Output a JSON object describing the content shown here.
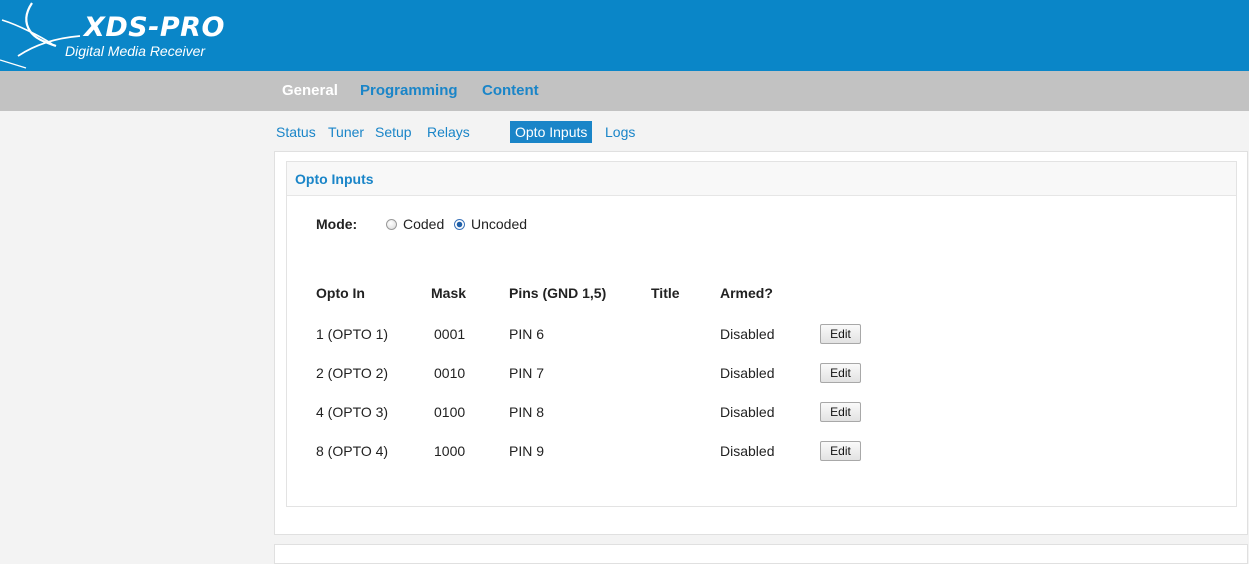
{
  "header": {
    "logo_title": "XDS-PRO",
    "logo_subtitle": "Digital Media Receiver",
    "background_color": "#0a86c8"
  },
  "main_nav": {
    "items": [
      {
        "label": "General",
        "active": true
      },
      {
        "label": "Programming",
        "active": false
      },
      {
        "label": "Content",
        "active": false
      }
    ]
  },
  "sub_nav": {
    "tabs": [
      {
        "label": "Status",
        "active": false
      },
      {
        "label": "Tuner",
        "active": false
      },
      {
        "label": "Setup",
        "active": false
      },
      {
        "label": "Relays",
        "active": false
      },
      {
        "label": "Opto Inputs",
        "active": true
      },
      {
        "label": "Logs",
        "active": false
      }
    ]
  },
  "panel": {
    "title": "Opto Inputs",
    "mode": {
      "label": "Mode:",
      "options": [
        {
          "label": "Coded",
          "selected": false
        },
        {
          "label": "Uncoded",
          "selected": true
        }
      ]
    },
    "table": {
      "columns": [
        "Opto In",
        "Mask",
        "Pins (GND 1,5)",
        "Title",
        "Armed?"
      ],
      "rows": [
        {
          "opto_in": "1 (OPTO 1)",
          "mask": "0001",
          "pins": "PIN 6",
          "title": "",
          "armed": "Disabled",
          "action": "Edit"
        },
        {
          "opto_in": "2 (OPTO 2)",
          "mask": "0010",
          "pins": "PIN 7",
          "title": "",
          "armed": "Disabled",
          "action": "Edit"
        },
        {
          "opto_in": "4 (OPTO 3)",
          "mask": "0100",
          "pins": "PIN 8",
          "title": "",
          "armed": "Disabled",
          "action": "Edit"
        },
        {
          "opto_in": "8 (OPTO 4)",
          "mask": "1000",
          "pins": "PIN 9",
          "title": "",
          "armed": "Disabled",
          "action": "Edit"
        }
      ]
    }
  },
  "colors": {
    "accent": "#1a85c8",
    "nav_bar": "#c2c2c2",
    "page_background": "#f3f3f3"
  },
  "icons": {
    "logo_swoosh": "xds-logo-swoosh-icon"
  }
}
